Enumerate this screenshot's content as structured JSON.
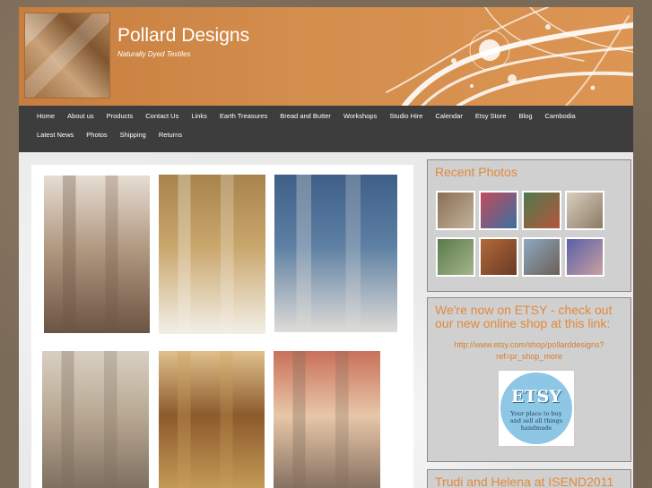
{
  "site": {
    "title": "Pollard Designs",
    "tagline": "Naturally Dyed Textiles"
  },
  "nav": {
    "row1": [
      "Home",
      "About us",
      "Products",
      "Contact Us",
      "Links",
      "Earth Treasures",
      "Bread and Butter",
      "Workshops",
      "Studio Hire",
      "Calendar",
      "Etsy Store",
      "Blog",
      "Cambodia"
    ],
    "row2": [
      "Latest News",
      "Photos",
      "Shipping",
      "Returns"
    ]
  },
  "photos": [
    {
      "name": "hanging-textiles-photo",
      "colors": [
        "#6b5443",
        "#b39a82",
        "#e6ddd3"
      ]
    },
    {
      "name": "felted-scarf-photo",
      "colors": [
        "#f3efe6",
        "#c9a66c",
        "#a6844c"
      ]
    },
    {
      "name": "blue-knit-shawl-photo",
      "colors": [
        "#dedcd7",
        "#5d7fa3",
        "#3f5f88"
      ]
    },
    {
      "name": "draped-garments-photo",
      "colors": [
        "#7a6a5c",
        "#b8a892",
        "#d8cfc3"
      ]
    },
    {
      "name": "woman-cushions-photo",
      "colors": [
        "#c9a05a",
        "#8c5a2c",
        "#e0c08a"
      ]
    },
    {
      "name": "kimono-mannequin-photo",
      "colors": [
        "#7d6a5a",
        "#e8c7a8",
        "#c9705a"
      ]
    }
  ],
  "sidebar": {
    "recent_photos": {
      "title": "Recent Photos",
      "thumbs": [
        {
          "name": "recent-photo-1",
          "colors": [
            "#8a6d52",
            "#c2b39c"
          ]
        },
        {
          "name": "recent-photo-2",
          "colors": [
            "#c34a5e",
            "#3a70a0"
          ]
        },
        {
          "name": "recent-photo-3",
          "colors": [
            "#4f7a4c",
            "#b4563d"
          ]
        },
        {
          "name": "recent-photo-4",
          "colors": [
            "#d7cfc0",
            "#8c7a62"
          ]
        },
        {
          "name": "recent-photo-5",
          "colors": [
            "#5a7a4a",
            "#a3b58c"
          ]
        },
        {
          "name": "recent-photo-6",
          "colors": [
            "#b2693a",
            "#6a3a24"
          ]
        },
        {
          "name": "recent-photo-7",
          "colors": [
            "#8fa8c2",
            "#6a5f55"
          ]
        },
        {
          "name": "recent-photo-8",
          "colors": [
            "#5a5fa8",
            "#c9a0a0"
          ]
        }
      ]
    },
    "etsy": {
      "title": "We're now on ETSY - check out our new online shop at this link:",
      "link": "http://www.etsy.com/shop/pollarddesigns?ref=pr_shop_more",
      "badge_word": "ETSY",
      "badge_tagline": "Your place to buy and sell all things handmade"
    },
    "isend": {
      "title": "Trudi and Helena at ISEND2011"
    }
  },
  "colors": {
    "header_orange": "#d38d4c",
    "nav_bg": "#3d3d3d",
    "accent_orange": "#e08a3c"
  }
}
